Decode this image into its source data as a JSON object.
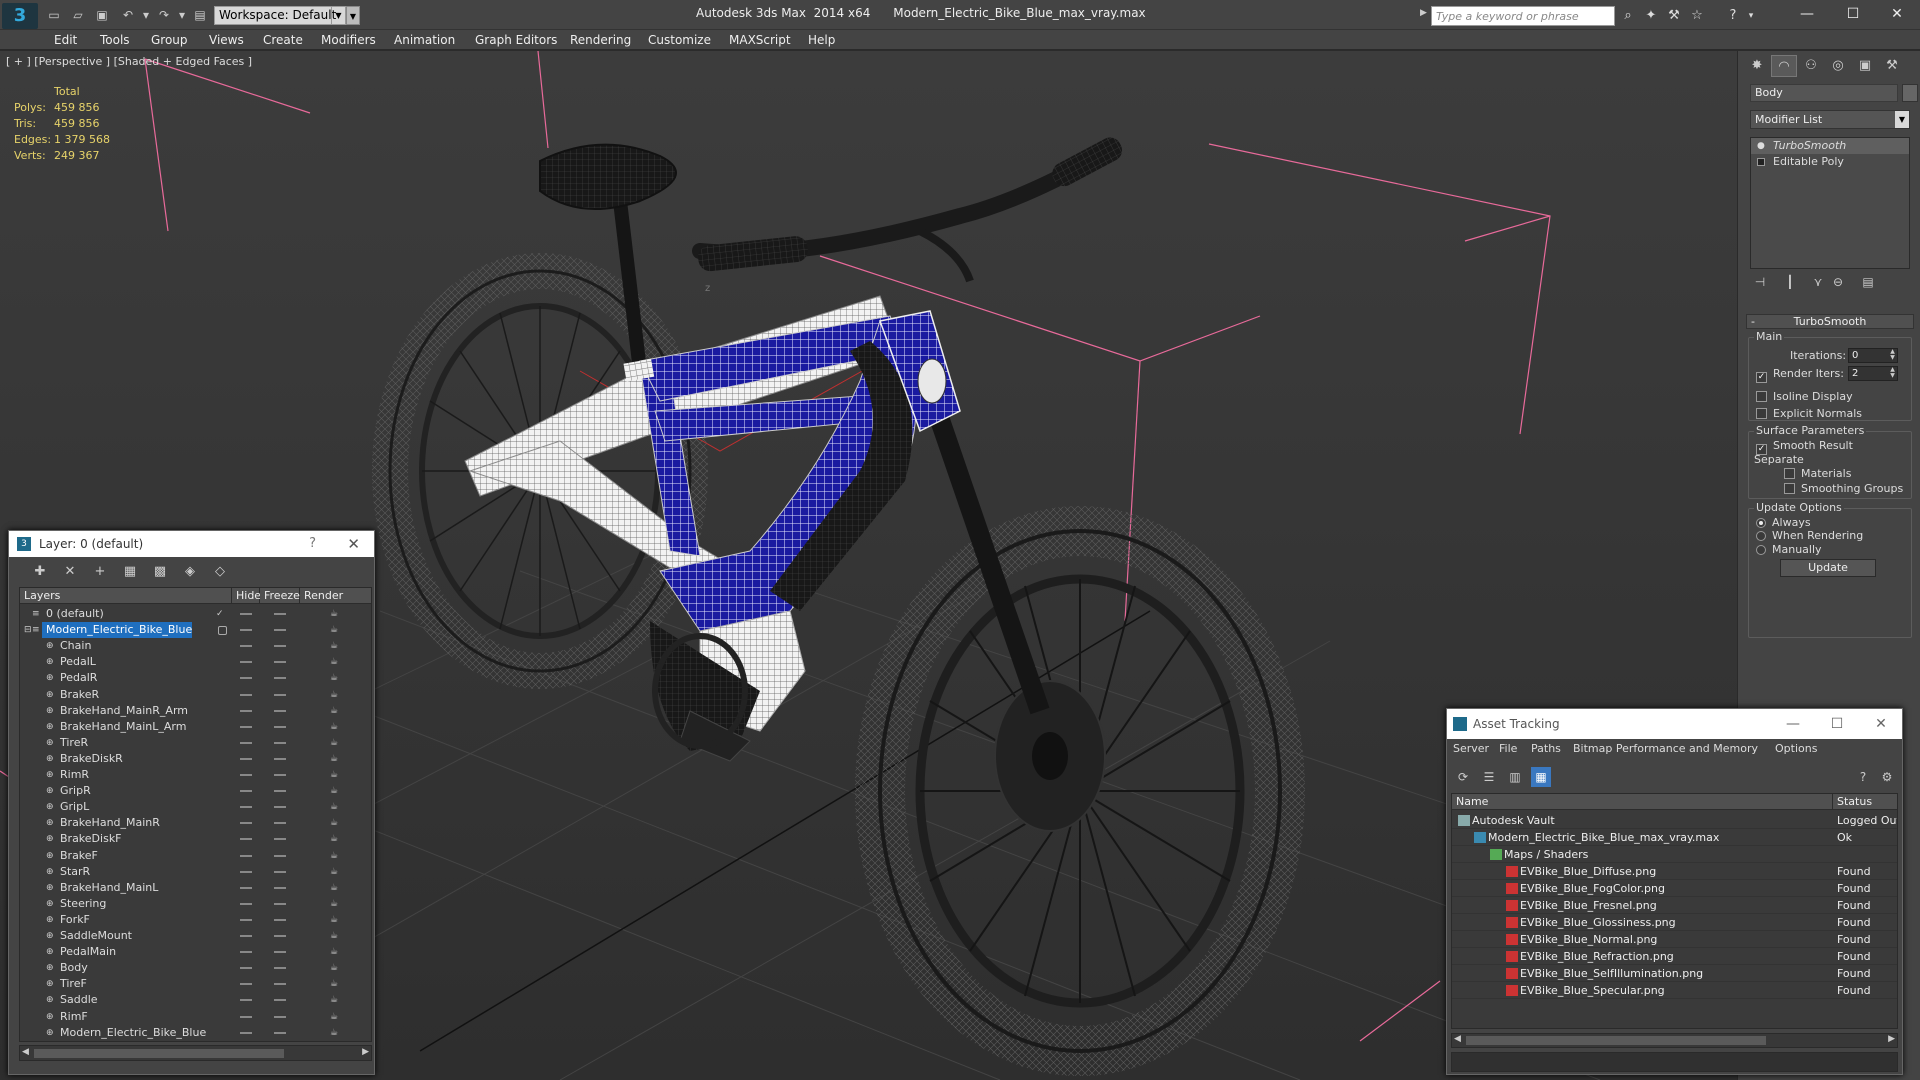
{
  "titlebar": {
    "workspace": "Workspace: Default",
    "app_title": "Autodesk 3ds Max  2014 x64      Modern_Electric_Bike_Blue_max_vray.max",
    "search_placeholder": "Type a keyword or phrase"
  },
  "menu": [
    "Edit",
    "Tools",
    "Group",
    "Views",
    "Create",
    "Modifiers",
    "Animation",
    "Graph Editors",
    "Rendering",
    "Customize",
    "MAXScript",
    "Help"
  ],
  "viewport": {
    "label": "[ + ] [Perspective ] [Shaded + Edged Faces ]",
    "stats": {
      "header": "Total",
      "rows": [
        {
          "label": "Polys:",
          "value": "459 856"
        },
        {
          "label": "Tris:",
          "value": "459 856"
        },
        {
          "label": "Edges:",
          "value": "1 379 568"
        },
        {
          "label": "Verts:",
          "value": "249 367"
        }
      ]
    },
    "axis_label": "z"
  },
  "command_panel": {
    "object_name": "Body",
    "modifier_list": "Modifier List",
    "stack": [
      "TurboSmooth",
      "Editable Poly"
    ],
    "turbosmooth": {
      "title": "TurboSmooth",
      "main": "Main",
      "iterations_label": "Iterations:",
      "iterations_value": "0",
      "render_iters_label": "Render Iters:",
      "render_iters_value": "2",
      "isoline": "Isoline Display",
      "explicit_normals": "Explicit Normals",
      "surface_params": "Surface Parameters",
      "smooth_result": "Smooth Result",
      "separate": "Separate",
      "materials": "Materials",
      "smoothing_groups": "Smoothing Groups",
      "update_options": "Update Options",
      "always": "Always",
      "when_rendering": "When Rendering",
      "manually": "Manually",
      "update_button": "Update"
    }
  },
  "layer_window": {
    "title": "Layer: 0 (default)",
    "columns": [
      "Layers",
      "Hide",
      "Freeze",
      "Render"
    ],
    "layers": [
      {
        "name": "0 (default)",
        "indent": 1,
        "type": "layer",
        "check": true
      },
      {
        "name": "Modern_Electric_Bike_Blue",
        "indent": 1,
        "type": "layer",
        "selected": true,
        "box": true
      },
      {
        "name": "Chain",
        "indent": 2,
        "type": "obj"
      },
      {
        "name": "PedalL",
        "indent": 2,
        "type": "obj"
      },
      {
        "name": "PedalR",
        "indent": 2,
        "type": "obj"
      },
      {
        "name": "BrakeR",
        "indent": 2,
        "type": "obj"
      },
      {
        "name": "BrakeHand_MainR_Arm",
        "indent": 2,
        "type": "obj"
      },
      {
        "name": "BrakeHand_MainL_Arm",
        "indent": 2,
        "type": "obj"
      },
      {
        "name": "TireR",
        "indent": 2,
        "type": "obj"
      },
      {
        "name": "BrakeDiskR",
        "indent": 2,
        "type": "obj"
      },
      {
        "name": "RimR",
        "indent": 2,
        "type": "obj"
      },
      {
        "name": "GripR",
        "indent": 2,
        "type": "obj"
      },
      {
        "name": "GripL",
        "indent": 2,
        "type": "obj"
      },
      {
        "name": "BrakeHand_MainR",
        "indent": 2,
        "type": "obj"
      },
      {
        "name": "BrakeDiskF",
        "indent": 2,
        "type": "obj"
      },
      {
        "name": "BrakeF",
        "indent": 2,
        "type": "obj"
      },
      {
        "name": "StarR",
        "indent": 2,
        "type": "obj"
      },
      {
        "name": "BrakeHand_MainL",
        "indent": 2,
        "type": "obj"
      },
      {
        "name": "Steering",
        "indent": 2,
        "type": "obj"
      },
      {
        "name": "ForkF",
        "indent": 2,
        "type": "obj"
      },
      {
        "name": "SaddleMount",
        "indent": 2,
        "type": "obj"
      },
      {
        "name": "PedalMain",
        "indent": 2,
        "type": "obj"
      },
      {
        "name": "Body",
        "indent": 2,
        "type": "obj"
      },
      {
        "name": "TireF",
        "indent": 2,
        "type": "obj"
      },
      {
        "name": "Saddle",
        "indent": 2,
        "type": "obj"
      },
      {
        "name": "RimF",
        "indent": 2,
        "type": "obj"
      },
      {
        "name": "Modern_Electric_Bike_Blue",
        "indent": 2,
        "type": "obj"
      }
    ]
  },
  "asset_window": {
    "title": "Asset Tracking",
    "menu": [
      "Server",
      "File",
      "Paths",
      "Bitmap Performance and Memory",
      "Options"
    ],
    "columns": [
      "Name",
      "Status"
    ],
    "rows": [
      {
        "name": "Autodesk Vault",
        "status": "Logged Out",
        "indent": 0,
        "icon": "vault"
      },
      {
        "name": "Modern_Electric_Bike_Blue_max_vray.max",
        "status": "Ok",
        "indent": 1,
        "icon": "max"
      },
      {
        "name": "Maps / Shaders",
        "status": "",
        "indent": 2,
        "icon": "maps"
      },
      {
        "name": "EVBike_Blue_Diffuse.png",
        "status": "Found",
        "indent": 3,
        "icon": "png"
      },
      {
        "name": "EVBike_Blue_FogColor.png",
        "status": "Found",
        "indent": 3,
        "icon": "png"
      },
      {
        "name": "EVBike_Blue_Fresnel.png",
        "status": "Found",
        "indent": 3,
        "icon": "png"
      },
      {
        "name": "EVBike_Blue_Glossiness.png",
        "status": "Found",
        "indent": 3,
        "icon": "png"
      },
      {
        "name": "EVBike_Blue_Normal.png",
        "status": "Found",
        "indent": 3,
        "icon": "png"
      },
      {
        "name": "EVBike_Blue_Refraction.png",
        "status": "Found",
        "indent": 3,
        "icon": "png"
      },
      {
        "name": "EVBike_Blue_SelfIllumination.png",
        "status": "Found",
        "indent": 3,
        "icon": "png"
      },
      {
        "name": "EVBike_Blue_Specular.png",
        "status": "Found",
        "indent": 3,
        "icon": "png"
      }
    ]
  },
  "colors": {
    "accent": "#1f6fbf",
    "stats_yellow": "#e7d36a",
    "bbox_pink": "#e86a9a",
    "frame_blue": "#1a1aa0"
  }
}
